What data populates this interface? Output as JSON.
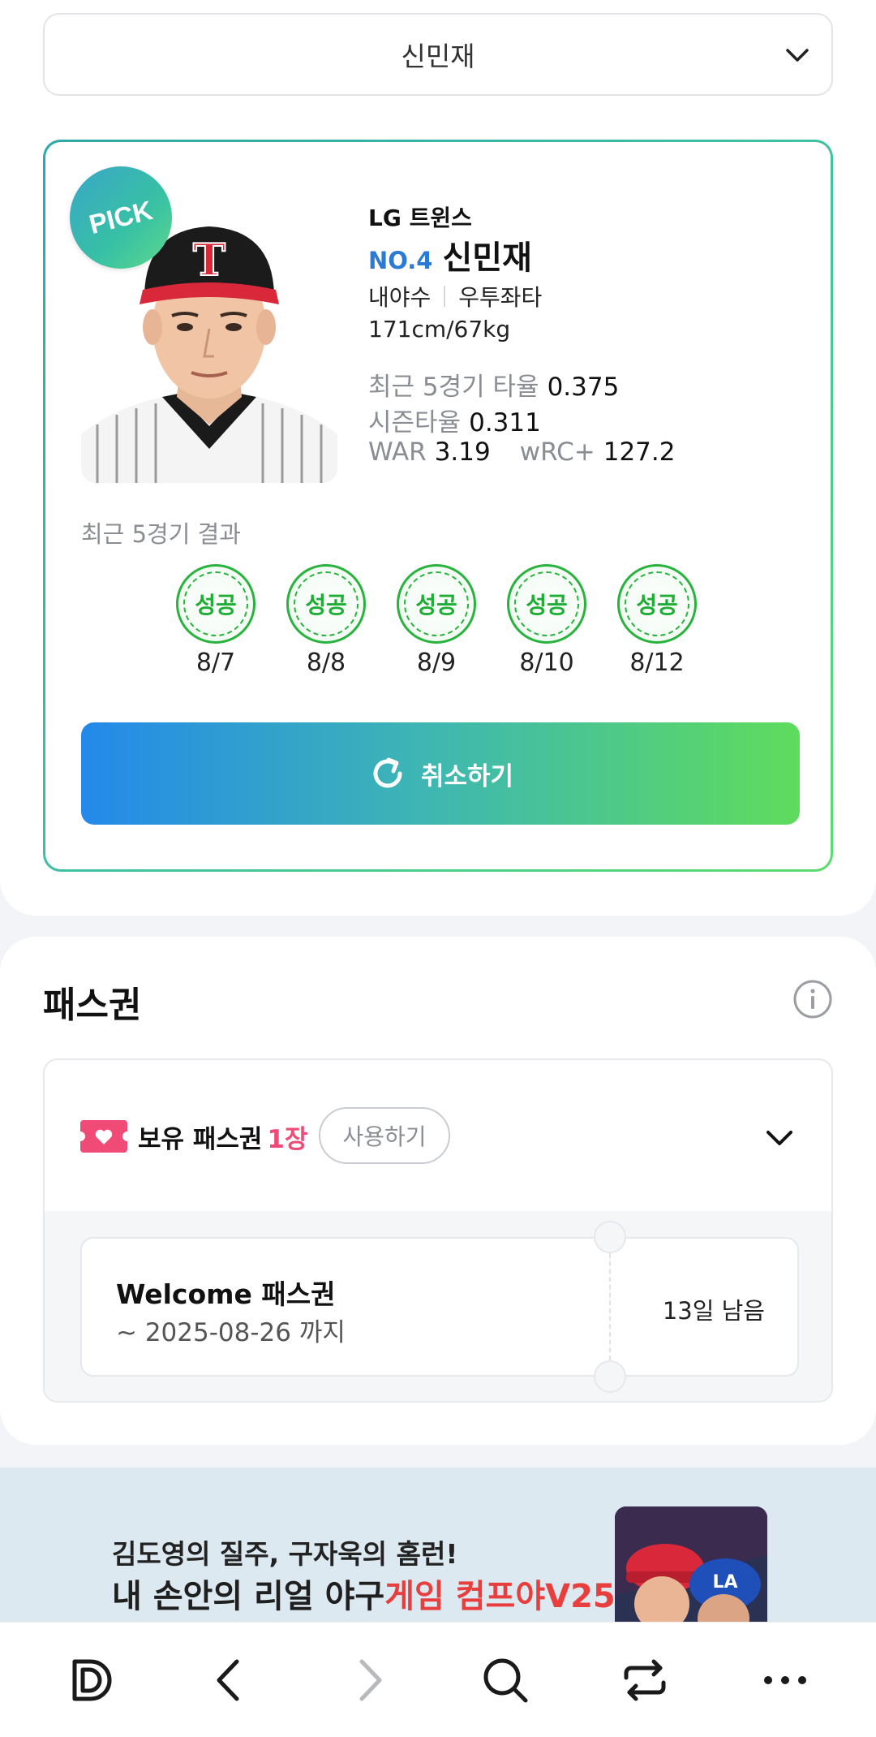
{
  "player_select": {
    "value": "신민재"
  },
  "player_card": {
    "badge": "PICK",
    "team": "LG 트윈스",
    "number": "NO.4",
    "name": "신민재",
    "position": "내야수",
    "bats_throws": "우투좌타",
    "body": "171cm/67kg",
    "stats": {
      "recent5_avg_label": "최근 5경기 타율",
      "recent5_avg": "0.375",
      "season_avg_label": "시즌타율",
      "season_avg": "0.311",
      "war_label": "WAR",
      "war": "3.19",
      "wrc_label": "wRC+",
      "wrc": "127.2"
    },
    "recent_results_title": "최근 5경기 결과",
    "results": [
      {
        "result": "성공",
        "date": "8/7"
      },
      {
        "result": "성공",
        "date": "8/8"
      },
      {
        "result": "성공",
        "date": "8/9"
      },
      {
        "result": "성공",
        "date": "8/10"
      },
      {
        "result": "성공",
        "date": "8/12"
      }
    ],
    "cancel_label": "취소하기"
  },
  "pass": {
    "title": "패스권",
    "owned_label": "보유 패스권",
    "owned_count": "1장",
    "use_label": "사용하기",
    "ticket": {
      "name": "Welcome 패스권",
      "expire": "~ 2025-08-26 까지",
      "remaining": "13일 남음"
    }
  },
  "banner": {
    "line1": "김도영의 질주, 구자욱의 홈런!",
    "line2_prefix": "내 손안의 리얼 야구",
    "line2_highlight": "게임 컴프야V25"
  },
  "colors": {
    "accent_blue": "#2a7ad6",
    "success_green": "#1fae35",
    "pass_pink": "#f04a77"
  },
  "bottom_nav": {
    "icons": [
      "d-logo-icon",
      "back-icon",
      "forward-icon",
      "search-icon",
      "share-icon",
      "more-icon"
    ]
  }
}
